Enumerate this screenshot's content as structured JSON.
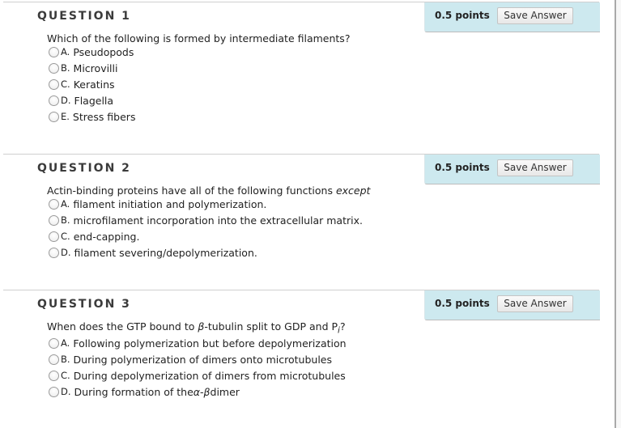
{
  "questions": [
    {
      "title": "QUESTION 1",
      "points": "0.5 points",
      "save_label": "Save Answer",
      "text": "Which of the following is formed by intermediate filaments?",
      "options": [
        {
          "letter": "A.",
          "text": "Pseudopods"
        },
        {
          "letter": "B.",
          "text": "Microvilli"
        },
        {
          "letter": "C.",
          "text": "Keratins"
        },
        {
          "letter": "D.",
          "text": "Flagella"
        },
        {
          "letter": "E.",
          "text": "Stress fibers"
        }
      ]
    },
    {
      "title": "QUESTION 2",
      "points": "0.5 points",
      "save_label": "Save Answer",
      "text": "Actin-binding proteins have all of the following functions ",
      "text_emphasis": "except",
      "options": [
        {
          "letter": "A.",
          "text": "filament initiation and polymerization."
        },
        {
          "letter": "B.",
          "text": "microfilament incorporation into the extracellular matrix."
        },
        {
          "letter": "C.",
          "text": "end-capping."
        },
        {
          "letter": "D.",
          "text": "filament severing/depolymerization."
        }
      ]
    },
    {
      "title": "QUESTION 3",
      "points": "0.5 points",
      "save_label": "Save Answer",
      "text_before": "When does the GTP bound to ",
      "text_beta": "β",
      "text_middle": "-tubulin split to GDP and P",
      "text_sub": "i",
      "text_end": "?",
      "options": [
        {
          "letter": "A.",
          "text": "Following polymerization but before depolymerization"
        },
        {
          "letter": "B.",
          "text": "During polymerization of dimers onto microtubules"
        },
        {
          "letter": "C.",
          "text": "During depolymerization of dimers from microtubules"
        },
        {
          "letter": "D.",
          "text": "During formation of the ",
          "alpha": "α",
          "dash": "-",
          "beta": "β",
          "after": " dimer"
        }
      ]
    }
  ]
}
